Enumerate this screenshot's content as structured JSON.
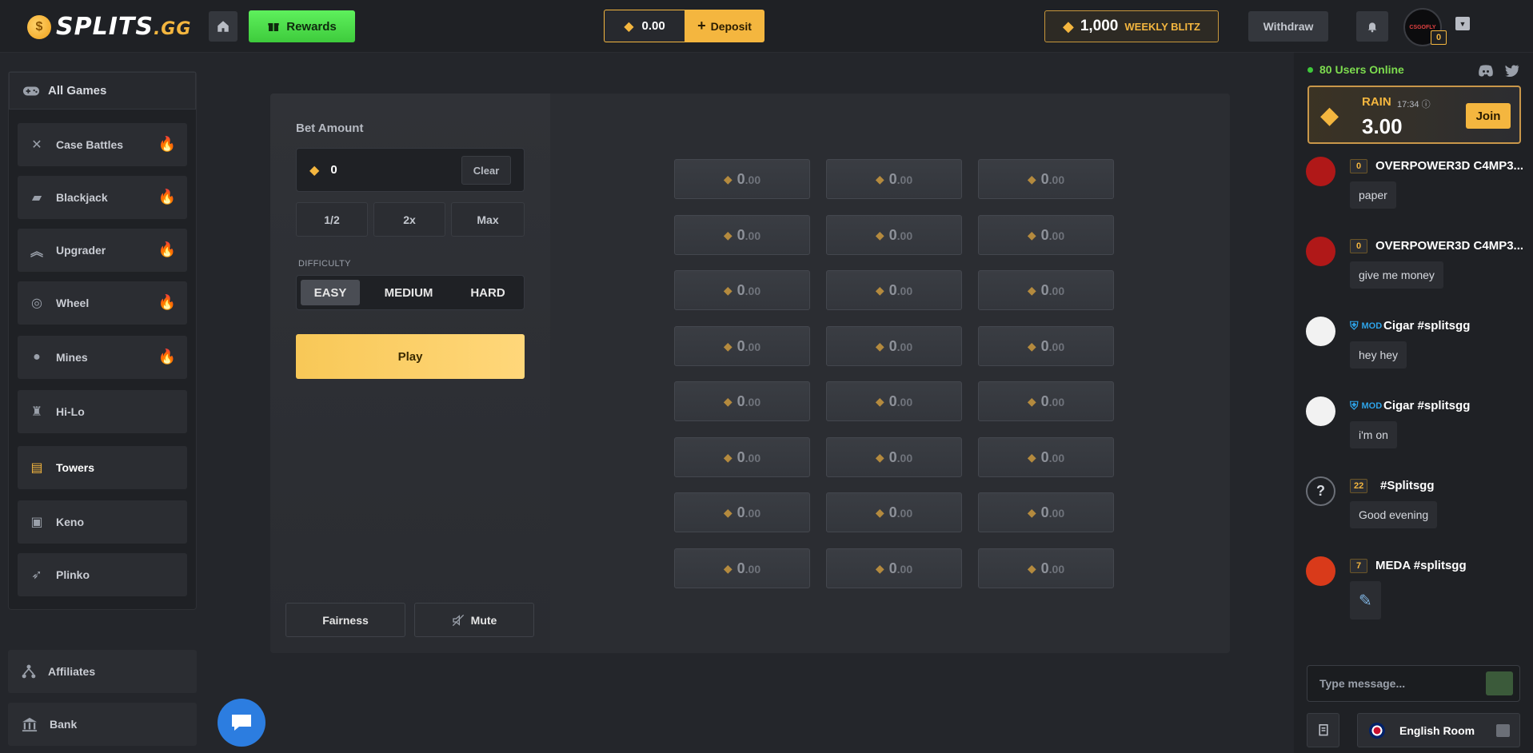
{
  "header": {
    "logo_text": "SPLITS",
    "logo_suffix": ".GG",
    "rewards_label": "Rewards",
    "balance": "0.00",
    "deposit_label": "Deposit",
    "blitz_amount": "1,000",
    "blitz_label": "WEEKLY BLITZ",
    "withdraw_label": "Withdraw",
    "avatar_text": "CSGOFLY",
    "user_level": "0"
  },
  "sidebar": {
    "all_games_label": "All Games",
    "games": [
      {
        "label": "Case Battles",
        "icon": "swords-icon",
        "hot": true
      },
      {
        "label": "Blackjack",
        "icon": "cards-icon",
        "hot": true
      },
      {
        "label": "Upgrader",
        "icon": "chevrons-up-icon",
        "hot": true
      },
      {
        "label": "Wheel",
        "icon": "wheel-icon",
        "hot": true
      },
      {
        "label": "Mines",
        "icon": "bomb-icon",
        "hot": true
      },
      {
        "label": "Hi-Lo",
        "icon": "hilo-icon",
        "hot": false
      },
      {
        "label": "Towers",
        "icon": "tower-icon",
        "hot": false,
        "active": true
      },
      {
        "label": "Keno",
        "icon": "keno-icon",
        "hot": false
      },
      {
        "label": "Plinko",
        "icon": "plinko-icon",
        "hot": false
      }
    ],
    "affiliates_label": "Affiliates",
    "bank_label": "Bank"
  },
  "controls": {
    "bet_label": "Bet Amount",
    "bet_value": "0",
    "clear_label": "Clear",
    "half_label": "1/2",
    "double_label": "2x",
    "max_label": "Max",
    "difficulty_label": "DIFFICULTY",
    "difficulties": [
      "EASY",
      "MEDIUM",
      "HARD"
    ],
    "selected_difficulty": "EASY",
    "play_label": "Play",
    "fairness_label": "Fairness",
    "mute_label": "Mute"
  },
  "tiles": {
    "rows": 8,
    "cols": 3,
    "value_int": "0",
    "value_dec": ".00"
  },
  "chat": {
    "online_text": "80 Users Online",
    "rain": {
      "title": "RAIN",
      "time": "17:34",
      "amount": "3.00",
      "join_label": "Join"
    },
    "messages": [
      {
        "level": "0",
        "mod": false,
        "name": "OVERPOWER3D C4MP3...",
        "text": "paper",
        "avatar_color": "#b01818"
      },
      {
        "level": "0",
        "mod": false,
        "name": "OVERPOWER3D C4MP3...",
        "text": "give me money",
        "avatar_color": "#b01818"
      },
      {
        "level": "MOD",
        "mod": true,
        "name": "Cigar #splitsgg",
        "text": "hey hey",
        "avatar_color": "#f2f2f2"
      },
      {
        "level": "MOD",
        "mod": true,
        "name": "Cigar #splitsgg",
        "text": "i'm on",
        "avatar_color": "#f2f2f2"
      },
      {
        "level": "22",
        "mod": false,
        "name": "#Splitsgg",
        "text": "Good evening",
        "avatar_color": "#1f2125"
      },
      {
        "level": "7",
        "mod": false,
        "name": "MEDA #splitsgg",
        "text": "",
        "avatar_color": "#d93a1a"
      }
    ],
    "input_placeholder": "Type message...",
    "room_label": "English Room"
  },
  "colors": {
    "accent": "#f4b63f",
    "green": "#4fe04c",
    "blue": "#2c7de0",
    "background": "#24262b"
  }
}
